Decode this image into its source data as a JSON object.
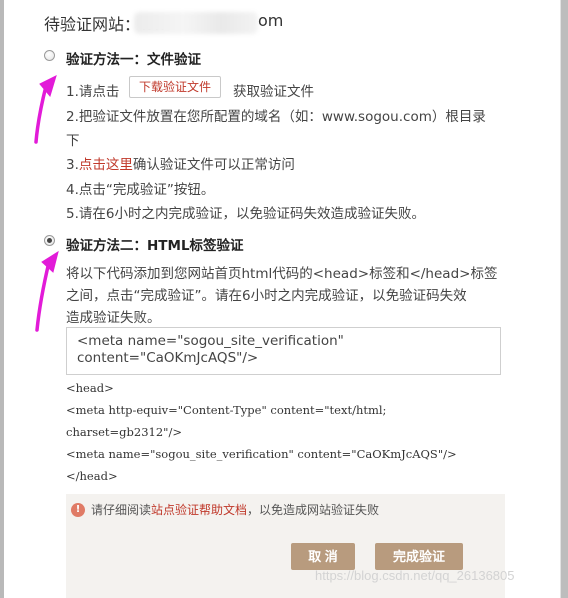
{
  "site": {
    "prefix": "待验证网站：ww",
    "suffix": "om"
  },
  "method1": {
    "title": "验证方法一：文件验证",
    "step1_prefix": "1.请点击",
    "download_button": "下载验证文件",
    "step1_suffix": "获取验证文件",
    "step2_line1": "2.把验证文件放置在您所配置的域名（如：www.sogou.com）根目录",
    "step2_line2": "下",
    "step3_prefix": "3.",
    "step3_link": "点击这里",
    "step3_suffix": "确认验证文件可以正常访问",
    "step4": "4.点击“完成验证”按钮。",
    "step5": "5.请在6小时之内完成验证，以免验证码失效造成验证失败。"
  },
  "method2": {
    "title": "验证方法二：HTML标签验证",
    "desc_line1": "将以下代码添加到您网站首页html代码的<head>标签和</head>标签",
    "desc_line2": "之间，点击“完成验证”。请在6小时之内完成验证，以免验证码失效",
    "desc_line3": "造成验证失败。",
    "meta_line1": "<meta name=\"sogou_site_verification\"",
    "meta_line2": "content=\"CaOKmJcAQS\"/>",
    "code": [
      "<head>",
      "<meta http-equiv=\"Content-Type\" content=\"text/html;",
      "charset=gb2312\"/>",
      "<meta name=\"sogou_site_verification\" content=\"CaOKmJcAQS\"/>",
      "</head>"
    ]
  },
  "notice": {
    "prefix": "请仔细阅读",
    "link": "站点验证帮助文档",
    "suffix": "，以免造成网站验证失败"
  },
  "buttons": {
    "cancel": "取 消",
    "done": "完成验证"
  },
  "watermark": "https://blog.csdn.net/qq_26136805",
  "colors": {
    "accent_red": "#c0392b",
    "button_bg": "#b89b7e",
    "arrow": "#e21bd8"
  }
}
